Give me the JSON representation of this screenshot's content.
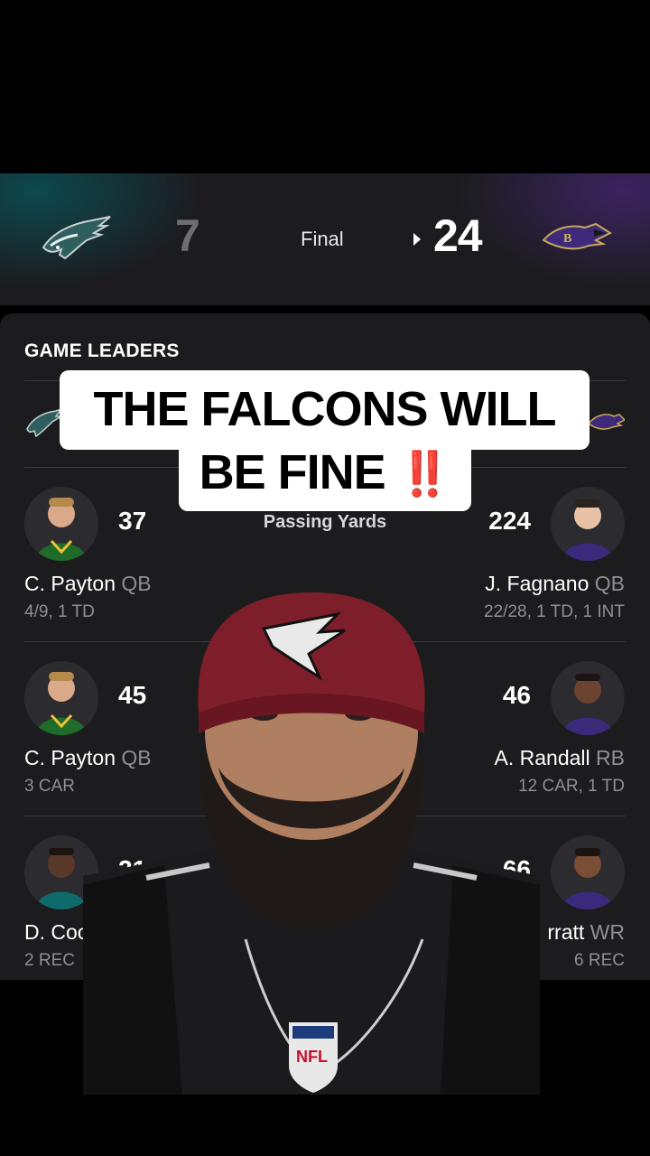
{
  "scoreboard": {
    "away_score": "7",
    "status": "Final",
    "home_score": "24"
  },
  "leaders": {
    "title": "GAME LEADERS",
    "categories": [
      {
        "label": "Passing Yards",
        "left": {
          "stat": "37",
          "name": "C. Payton",
          "pos": "QB",
          "line": "4/9, 1 TD"
        },
        "right": {
          "stat": "224",
          "name": "J. Fagnano",
          "pos": "QB",
          "line": "22/28, 1 TD, 1 INT"
        }
      },
      {
        "label": "",
        "left": {
          "stat": "45",
          "name": "C. Payton",
          "pos": "QB",
          "line": "3 CAR"
        },
        "right": {
          "stat": "46",
          "name": "A. Randall",
          "pos": "RB",
          "line": "12 CAR, 1 TD"
        }
      },
      {
        "label": "",
        "left": {
          "stat": "21",
          "name": "D. Coo",
          "pos": "",
          "line": "2 REC"
        },
        "right": {
          "stat": "66",
          "name": "rratt",
          "pos": "WR",
          "line": "6 REC"
        }
      }
    ]
  },
  "caption": {
    "line1": "THE FALCONS WILL",
    "line2": "BE FINE",
    "emoji": "‼️"
  },
  "colors": {
    "eagles_green": "#004c54",
    "ravens_purple": "#241773",
    "falcons_red": "#8a1c2a"
  },
  "icons": [
    "eagles-logo",
    "ravens-logo",
    "falcons-logo",
    "nfl-shield"
  ]
}
